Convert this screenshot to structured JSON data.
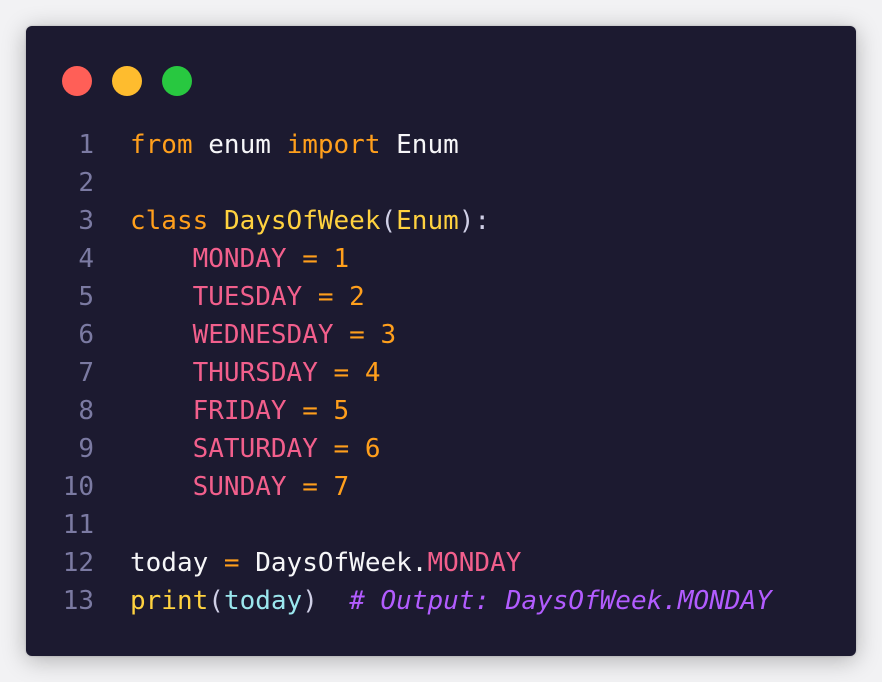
{
  "window": {
    "controls": {
      "close_color": "#ff5f57",
      "minimize_color": "#febc2e",
      "maximize_color": "#28c840"
    }
  },
  "theme": {
    "background": "#1c1a30",
    "keyword": "#ff9f1c",
    "class_name": "#ffd23f",
    "constant": "#f25f8c",
    "comment": "#b25cff",
    "line_number": "#7b7aa2"
  },
  "code": {
    "lines": [
      {
        "n": "1",
        "tokens": [
          {
            "t": "from",
            "c": "kw"
          },
          {
            "t": " ",
            "c": "ident"
          },
          {
            "t": "enum",
            "c": "ident"
          },
          {
            "t": " ",
            "c": "ident"
          },
          {
            "t": "import",
            "c": "kw"
          },
          {
            "t": " ",
            "c": "ident"
          },
          {
            "t": "Enum",
            "c": "ident"
          }
        ]
      },
      {
        "n": "2",
        "tokens": []
      },
      {
        "n": "3",
        "tokens": [
          {
            "t": "class",
            "c": "kw"
          },
          {
            "t": " ",
            "c": "ident"
          },
          {
            "t": "DaysOfWeek",
            "c": "cls"
          },
          {
            "t": "(",
            "c": "paren"
          },
          {
            "t": "Enum",
            "c": "cls"
          },
          {
            "t": "):",
            "c": "paren"
          }
        ]
      },
      {
        "n": "4",
        "tokens": [
          {
            "t": "    ",
            "c": "ident"
          },
          {
            "t": "MONDAY",
            "c": "const"
          },
          {
            "t": " = ",
            "c": "op"
          },
          {
            "t": "1",
            "c": "num"
          }
        ]
      },
      {
        "n": "5",
        "tokens": [
          {
            "t": "    ",
            "c": "ident"
          },
          {
            "t": "TUESDAY",
            "c": "const"
          },
          {
            "t": " = ",
            "c": "op"
          },
          {
            "t": "2",
            "c": "num"
          }
        ]
      },
      {
        "n": "6",
        "tokens": [
          {
            "t": "    ",
            "c": "ident"
          },
          {
            "t": "WEDNESDAY",
            "c": "const"
          },
          {
            "t": " = ",
            "c": "op"
          },
          {
            "t": "3",
            "c": "num"
          }
        ]
      },
      {
        "n": "7",
        "tokens": [
          {
            "t": "    ",
            "c": "ident"
          },
          {
            "t": "THURSDAY",
            "c": "const"
          },
          {
            "t": " = ",
            "c": "op"
          },
          {
            "t": "4",
            "c": "num"
          }
        ]
      },
      {
        "n": "8",
        "tokens": [
          {
            "t": "    ",
            "c": "ident"
          },
          {
            "t": "FRIDAY",
            "c": "const"
          },
          {
            "t": " = ",
            "c": "op"
          },
          {
            "t": "5",
            "c": "num"
          }
        ]
      },
      {
        "n": "9",
        "tokens": [
          {
            "t": "    ",
            "c": "ident"
          },
          {
            "t": "SATURDAY",
            "c": "const"
          },
          {
            "t": " = ",
            "c": "op"
          },
          {
            "t": "6",
            "c": "num"
          }
        ]
      },
      {
        "n": "10",
        "tokens": [
          {
            "t": "    ",
            "c": "ident"
          },
          {
            "t": "SUNDAY",
            "c": "const"
          },
          {
            "t": " = ",
            "c": "op"
          },
          {
            "t": "7",
            "c": "num"
          }
        ]
      },
      {
        "n": "11",
        "tokens": []
      },
      {
        "n": "12",
        "tokens": [
          {
            "t": "today",
            "c": "ident"
          },
          {
            "t": " = ",
            "c": "op"
          },
          {
            "t": "DaysOfWeek",
            "c": "ident"
          },
          {
            "t": ".",
            "c": "ident"
          },
          {
            "t": "MONDAY",
            "c": "const"
          }
        ]
      },
      {
        "n": "13",
        "tokens": [
          {
            "t": "print",
            "c": "fn"
          },
          {
            "t": "(",
            "c": "paren"
          },
          {
            "t": "today",
            "c": "arg"
          },
          {
            "t": ")",
            "c": "paren"
          },
          {
            "t": "  ",
            "c": "ident"
          },
          {
            "t": "# Output: DaysOfWeek.MONDAY",
            "c": "cmt"
          }
        ]
      }
    ]
  }
}
